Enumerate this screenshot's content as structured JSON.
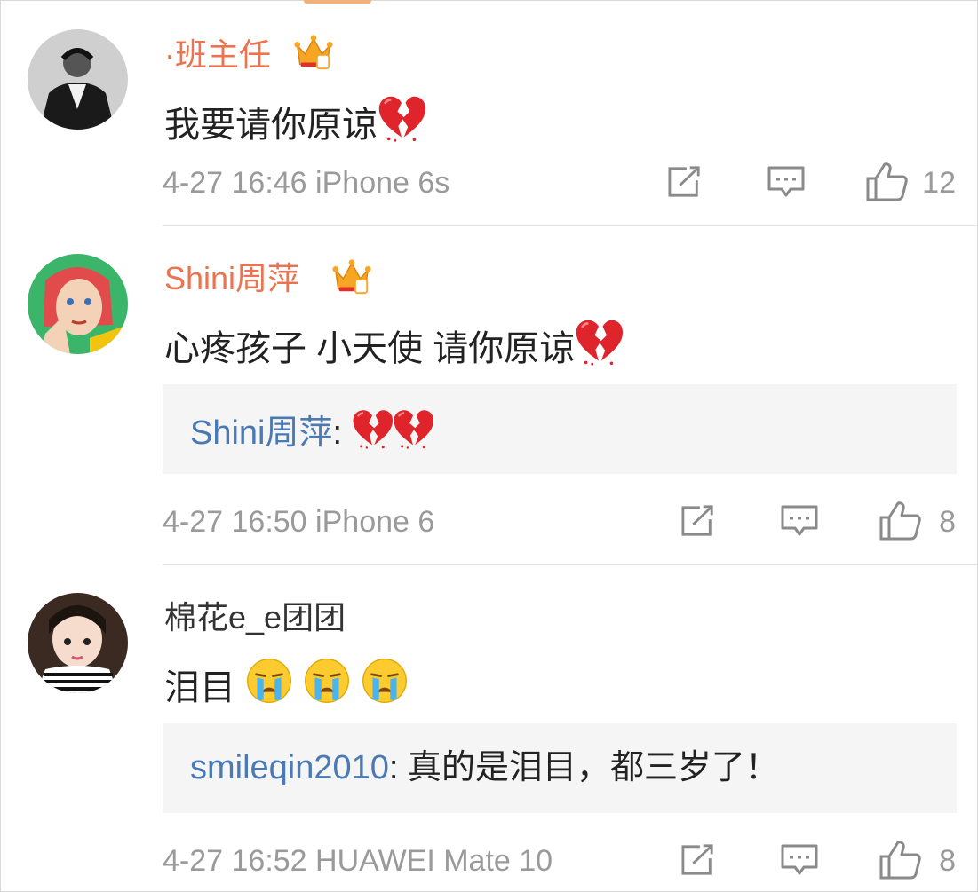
{
  "comments": [
    {
      "name": "·班主任",
      "text": "我要请你原谅",
      "emoji": "broken-heart",
      "time": "4-27 16:46",
      "device": "iPhone 6s",
      "likes": "12",
      "badge_level": "3"
    },
    {
      "name": "Shini周萍",
      "text": "心疼孩子 小天使 请你原谅",
      "emoji": "broken-heart",
      "reply_user": "Shini周萍",
      "reply_sep": ":",
      "reply_emoji": "broken-heart x2",
      "time": "4-27 16:50",
      "device": "iPhone 6",
      "likes": "8",
      "badge_level": "6"
    },
    {
      "name": "棉花e_e团团",
      "text": "泪目",
      "emoji": "crying-face x3",
      "reply_user": "smileqin2010",
      "reply_sep": ":",
      "reply_text": " 真的是泪目，都三岁了！",
      "time": "4-27 16:52",
      "device": "HUAWEI Mate 10",
      "likes": "8"
    }
  ],
  "colors": {
    "vip_name": "#eb7350",
    "reply_user": "#4a79b4",
    "meta": "#9a9a9a",
    "reply_bg": "#f5f5f5"
  }
}
